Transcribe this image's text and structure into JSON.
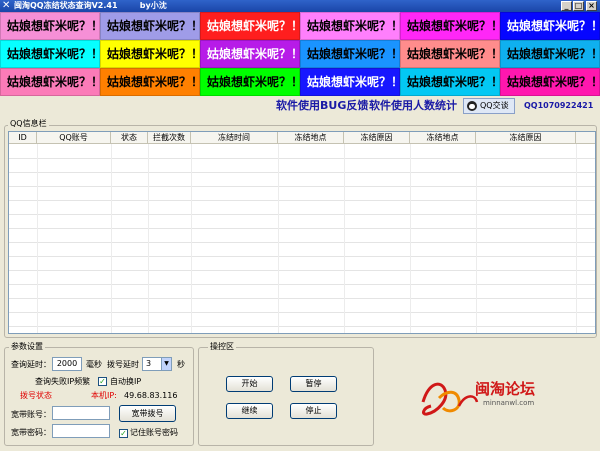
{
  "window": {
    "title": "闽淘QQ冻结状态查询V2.41        by小沈",
    "min_label": "_",
    "max_label": "□",
    "close_label": "×"
  },
  "banner": {
    "text": "姑娘想虾米呢？！",
    "colors": [
      [
        "#f68fd6",
        "#9f9ce8",
        "#ff1e1e",
        "#ff7ffc",
        "#ff27f7",
        "#0606ff"
      ],
      [
        "#07ffff",
        "#ffff00",
        "#b71be8",
        "#1a94ff",
        "#ff8c8c",
        "#0fb0ef"
      ],
      [
        "#fb7bb8",
        "#ff8000",
        "#00ff00",
        "#1717ff",
        "#03c8f3",
        "#ff17ae"
      ]
    ]
  },
  "links": {
    "bug_feedback": "软件使用BUG反馈",
    "user_stats": "软件使用人数统计",
    "qq_chat": "QQ交谈",
    "qq_number": "QQ1070922421"
  },
  "qq_info": {
    "label": "QQ信息栏",
    "columns": [
      "ID",
      "QQ账号",
      "状态",
      "拦截次数",
      "冻结时间",
      "冻结地点",
      "冻结原因",
      "冻结地点",
      "冻结原因"
    ]
  },
  "params": {
    "label": "参数设置",
    "query_delay_label": "查询延时：",
    "query_delay_value": "2000",
    "ms_unit": "毫秒",
    "dial_delay_label": "拨号延时",
    "dial_delay_value": "3",
    "sec_unit": "秒",
    "retry_fail_label": "查询失败IP频繁",
    "auto_ip_label": "自动换IP",
    "auto_ip_checked": true,
    "dial_status_label": "拨号状态",
    "local_ip_label": "本机IP:",
    "local_ip_value": "49.68.83.116",
    "bb_account_label": "宽带账号：",
    "bb_account_value": "",
    "bb_password_label": "宽带密码：",
    "bb_password_value": "",
    "dial_button": "宽带拨号",
    "remember_label": "记住账号密码",
    "remember_checked": true
  },
  "control": {
    "label": "操控区",
    "start": "开始",
    "pause": "暂停",
    "resume": "继续",
    "stop": "停止"
  },
  "logo": {
    "text_main": "闽淘论坛",
    "text_url": "minnanwl.com"
  }
}
